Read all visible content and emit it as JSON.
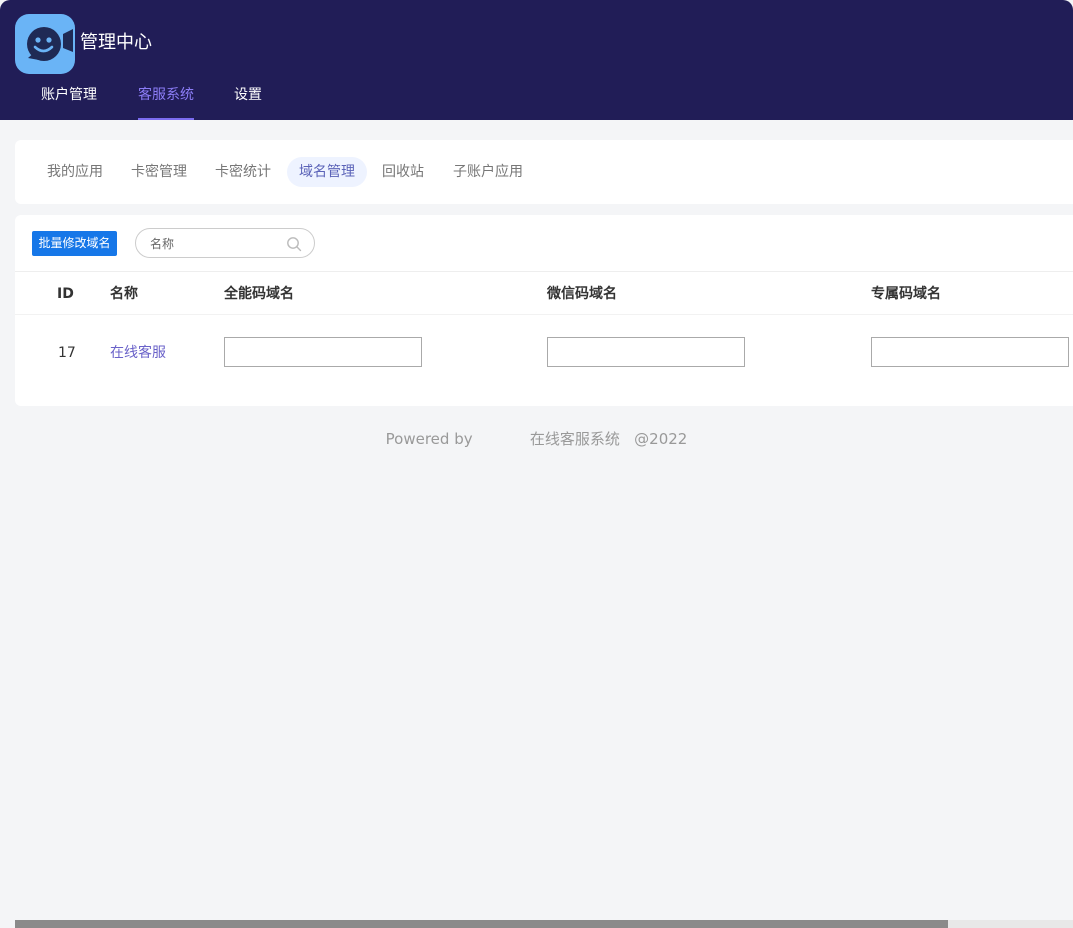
{
  "header": {
    "app_title": "管理中心",
    "nav": [
      {
        "label": "账户管理",
        "active": false
      },
      {
        "label": "客服系统",
        "active": true
      },
      {
        "label": "设置",
        "active": false
      }
    ]
  },
  "subnav": {
    "tabs": [
      {
        "label": "我的应用",
        "active": false
      },
      {
        "label": "卡密管理",
        "active": false
      },
      {
        "label": "卡密统计",
        "active": false
      },
      {
        "label": "域名管理",
        "active": true
      },
      {
        "label": "回收站",
        "active": false
      },
      {
        "label": "子账户应用",
        "active": false
      }
    ]
  },
  "toolbar": {
    "batch_button": "批量修改域名",
    "search_placeholder": "名称"
  },
  "table": {
    "headers": [
      "ID",
      "名称",
      "全能码域名",
      "微信码域名",
      "专属码域名"
    ],
    "rows": [
      {
        "id": "17",
        "name": "在线客服",
        "all_domain": "",
        "wechat_domain": "",
        "exclusive_domain": ""
      }
    ]
  },
  "footer": {
    "powered_by": "Powered by",
    "system_name": "在线客服系统",
    "year": "@2022"
  },
  "colors": {
    "header_bg": "#211d57",
    "accent": "#7b6cf0",
    "button_blue": "#1677e8",
    "logo_bg": "#6ab4f6"
  },
  "icons": {
    "logo": "chat-bubble-smile-icon",
    "search": "search-icon"
  }
}
